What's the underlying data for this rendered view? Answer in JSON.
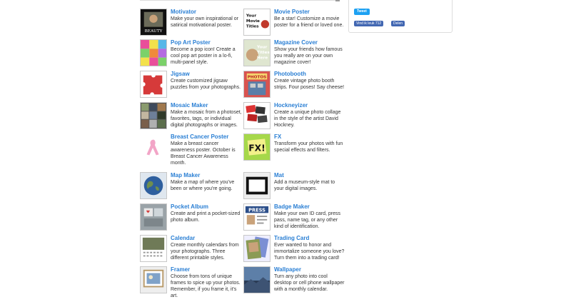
{
  "sidebar": {
    "tweet_label": "Tweet",
    "like_label": "Vind ik leuk 712",
    "share_label": "Delen"
  },
  "left": [
    {
      "title": "Motivator",
      "desc": "Make your own inspirational or satirical motivational poster.",
      "icon": "motivator-icon"
    },
    {
      "title": "Pop Art Poster",
      "desc": "Become a pop icon! Create a cool pop art poster in a lo-fi, multi-panel style.",
      "icon": "pop-art-icon"
    },
    {
      "title": "Jigsaw",
      "desc": "Create customized jigsaw puzzles from your photographs.",
      "icon": "jigsaw-icon"
    },
    {
      "title": "Mosaic Maker",
      "desc": "Make a mosaic from a photoset, favorites, tags, or individual digital photographs or images.",
      "icon": "mosaic-icon"
    },
    {
      "title": "Breast Cancer Poster",
      "desc": "Make a breast cancer awareness poster. October is Breast Cancer Awareness month.",
      "icon": "pink-ribbon-icon"
    },
    {
      "title": "Map Maker",
      "desc": "Make a map of where you've been or where you're going.",
      "icon": "globe-icon"
    },
    {
      "title": "Pocket Album",
      "desc": "Create and print a pocket-sized photo album.",
      "icon": "pocket-album-icon"
    },
    {
      "title": "Calendar",
      "desc": "Create monthly calendars from your photographs. Three different printable styles.",
      "icon": "calendar-icon"
    },
    {
      "title": "Framer",
      "desc": "Choose from tons of unique frames to spice up your photos. Remember, if you frame it, it's art.",
      "icon": "frame-icon"
    }
  ],
  "right": [
    {
      "title": "Movie Poster",
      "desc": "Be a star! Customize a movie poster for a friend or loved one.",
      "icon": "movie-poster-icon"
    },
    {
      "title": "Magazine Cover",
      "desc": "Show your friends how famous you really are on your own magazine cover!",
      "icon": "magazine-icon"
    },
    {
      "title": "Photobooth",
      "desc": "Create vintage photo booth strips. Four poses! Say cheese!",
      "icon": "photobooth-icon"
    },
    {
      "title": "Hockneyizer",
      "desc": "Create a unique photo collage in the style of the artist David Hockney.",
      "icon": "hockney-icon"
    },
    {
      "title": "FX",
      "desc": "Transform your photos with fun special effects and filters.",
      "icon": "fx-icon"
    },
    {
      "title": "Mat",
      "desc": "Add a museum-style mat to your digital images.",
      "icon": "mat-icon"
    },
    {
      "title": "Badge Maker",
      "desc": "Make your own ID card, press pass, name tag, or any other kind of identification.",
      "icon": "badge-icon"
    },
    {
      "title": "Trading Card",
      "desc": "Ever wanted to honor and immortalize someone you love? Turn them into a trading card!",
      "icon": "trading-card-icon"
    },
    {
      "title": "Wallpaper",
      "desc": "Turn any photo into cool desktop or cell phone wallpaper with a monthly calendar.",
      "icon": "wallpaper-icon"
    }
  ],
  "thumb_text": {
    "motivator": "BEAUTY",
    "movie": "Your Movie Titles",
    "magazine": "Your Titles Here",
    "photobooth": "PHOTOS",
    "fx": "FX!",
    "press": "PRESS"
  }
}
